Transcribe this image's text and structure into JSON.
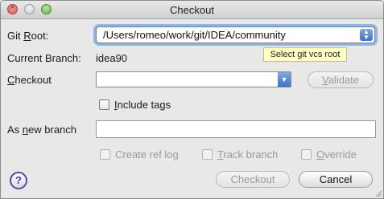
{
  "window": {
    "title": "Checkout"
  },
  "labels": {
    "git_root_prefix": "Git ",
    "git_root_u": "R",
    "git_root_suffix": "oot:",
    "current_branch": "Current Branch:",
    "checkout_u": "C",
    "checkout_suffix": "heckout",
    "as_new_prefix": "As ",
    "as_new_u": "n",
    "as_new_suffix": "ew branch"
  },
  "git_root": {
    "value": "/Users/romeo/work/git/IDEA/community",
    "tooltip": "Select git vcs root"
  },
  "current_branch": {
    "value": "idea90"
  },
  "checkout": {
    "value": ""
  },
  "validate_button": {
    "prefix": "",
    "u": "V",
    "suffix": "alidate"
  },
  "include_tags": {
    "prefix": "",
    "u": "I",
    "suffix": "nclude tags",
    "checked": false
  },
  "new_branch": {
    "value": ""
  },
  "options": {
    "create_ref_log": {
      "label": "Create ref log"
    },
    "track_branch": {
      "prefix": "",
      "u": "T",
      "suffix": "rack branch"
    },
    "override": {
      "prefix": "",
      "u": "O",
      "suffix": "verride"
    }
  },
  "buttons": {
    "checkout": "Checkout",
    "cancel": "Cancel"
  },
  "icons": {
    "help": "?",
    "combo_arrows": "▲▼",
    "dropdown": "▼",
    "close_glyph": "×"
  }
}
